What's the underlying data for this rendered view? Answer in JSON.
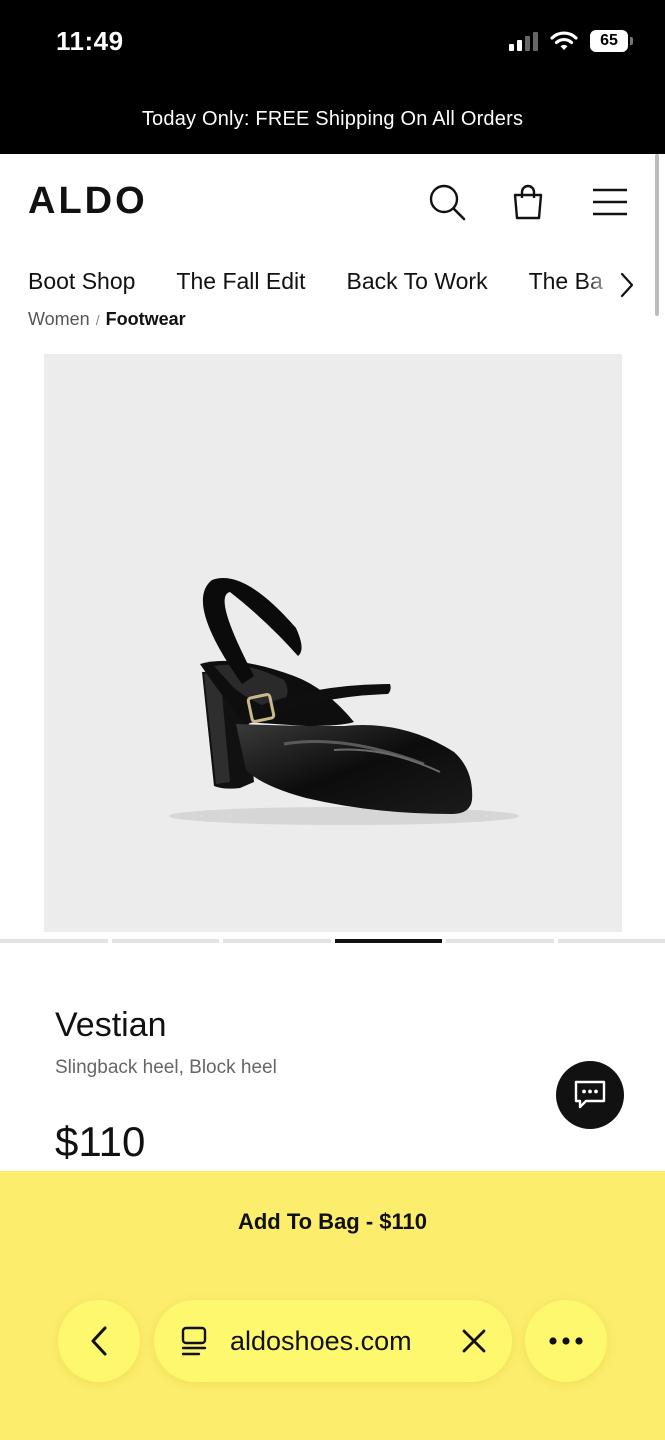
{
  "status_bar": {
    "time": "11:49",
    "battery": "65"
  },
  "promo": {
    "text": "Today Only: FREE Shipping On All Orders"
  },
  "header": {
    "logo": "ALDO"
  },
  "nav": {
    "items": [
      "Boot Shop",
      "The Fall Edit",
      "Back To Work",
      "The Ba"
    ]
  },
  "breadcrumb": {
    "parent": "Women",
    "separator": "/",
    "current": "Footwear"
  },
  "product": {
    "name": "Vestian",
    "description": "Slingback heel, Block heel",
    "price": "$110",
    "image_count": 6,
    "active_image": 4
  },
  "cta": {
    "add_to_bag": "Add To Bag - $110"
  },
  "browser": {
    "url": "aldoshoes.com"
  },
  "colors": {
    "cta_yellow": "#fced6c",
    "browser_pill": "#fef86f",
    "image_bg": "#ececec"
  },
  "icons": [
    "search-icon",
    "shopping-bag-icon",
    "hamburger-menu-icon",
    "chevron-right-icon",
    "chat-icon",
    "back-chevron-icon",
    "tabs-icon",
    "close-icon",
    "more-icon"
  ]
}
